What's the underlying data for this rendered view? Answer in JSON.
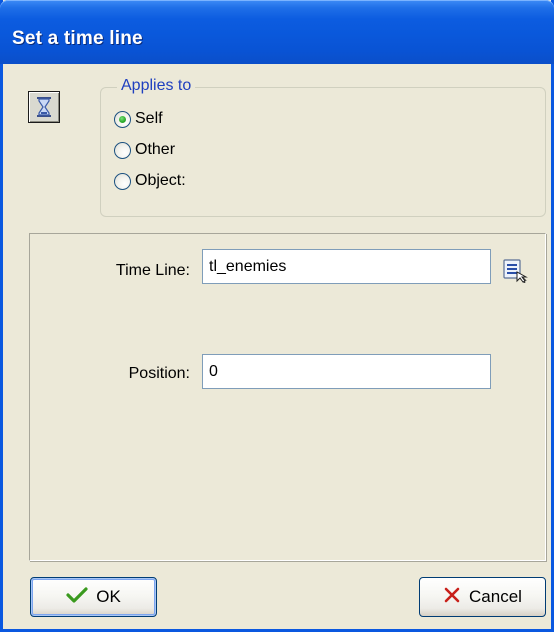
{
  "window": {
    "title": "Set a time line"
  },
  "action_icon": {
    "icon": "hourglass-icon"
  },
  "applies_to": {
    "legend": "Applies to",
    "options": [
      {
        "label": "Self",
        "checked": true
      },
      {
        "label": "Other",
        "checked": false
      },
      {
        "label": "Object:",
        "checked": false
      }
    ]
  },
  "arguments": {
    "time_line_label": "Time Line:",
    "time_line_value": "tl_enemies",
    "position_label": "Position:",
    "position_value": "0",
    "menu_icon": "list-menu-icon"
  },
  "buttons": {
    "ok_label": "OK",
    "cancel_label": "Cancel"
  },
  "colors": {
    "titlebar": "#0a58db",
    "window_bg": "#ece9d8",
    "legend_text": "#1f3fbf",
    "radio_checked": "#2fae2f",
    "ok_check": "#3a9a1e",
    "cancel_x": "#c8201a"
  }
}
